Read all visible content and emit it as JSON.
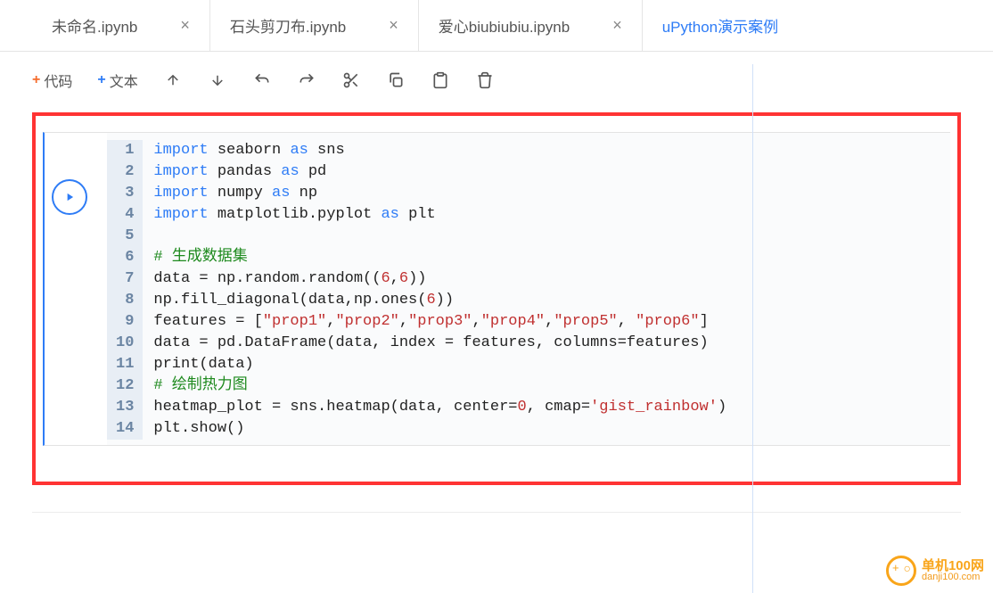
{
  "tabs": [
    {
      "label": "未命名.ipynb",
      "active": false
    },
    {
      "label": "石头剪刀布.ipynb",
      "active": false
    },
    {
      "label": "爱心biubiubiu.ipynb",
      "active": false
    },
    {
      "label": "uPython演示案例",
      "active": true
    }
  ],
  "toolbar": {
    "add_code": "代码",
    "add_text": "文本"
  },
  "code": {
    "lines": [
      {
        "n": 1,
        "tokens": [
          {
            "t": "import",
            "c": "kw"
          },
          {
            "t": " seaborn "
          },
          {
            "t": "as",
            "c": "kw"
          },
          {
            "t": " sns"
          }
        ]
      },
      {
        "n": 2,
        "tokens": [
          {
            "t": "import",
            "c": "kw"
          },
          {
            "t": " pandas "
          },
          {
            "t": "as",
            "c": "kw"
          },
          {
            "t": " pd"
          }
        ]
      },
      {
        "n": 3,
        "tokens": [
          {
            "t": "import",
            "c": "kw"
          },
          {
            "t": " numpy "
          },
          {
            "t": "as",
            "c": "kw"
          },
          {
            "t": " np"
          }
        ]
      },
      {
        "n": 4,
        "tokens": [
          {
            "t": "import",
            "c": "kw"
          },
          {
            "t": " matplotlib.pyplot "
          },
          {
            "t": "as",
            "c": "kw"
          },
          {
            "t": " plt"
          }
        ]
      },
      {
        "n": 5,
        "tokens": [
          {
            "t": ""
          }
        ]
      },
      {
        "n": 6,
        "tokens": [
          {
            "t": "# 生成数据集",
            "c": "com"
          }
        ]
      },
      {
        "n": 7,
        "tokens": [
          {
            "t": "data = np.random.random(("
          },
          {
            "t": "6",
            "c": "num"
          },
          {
            "t": ","
          },
          {
            "t": "6",
            "c": "num"
          },
          {
            "t": "))"
          }
        ]
      },
      {
        "n": 8,
        "tokens": [
          {
            "t": "np.fill_diagonal(data,np.ones("
          },
          {
            "t": "6",
            "c": "num"
          },
          {
            "t": "))"
          }
        ]
      },
      {
        "n": 9,
        "tokens": [
          {
            "t": "features = ["
          },
          {
            "t": "\"prop1\"",
            "c": "str"
          },
          {
            "t": ","
          },
          {
            "t": "\"prop2\"",
            "c": "str"
          },
          {
            "t": ","
          },
          {
            "t": "\"prop3\"",
            "c": "str"
          },
          {
            "t": ","
          },
          {
            "t": "\"prop4\"",
            "c": "str"
          },
          {
            "t": ","
          },
          {
            "t": "\"prop5\"",
            "c": "str"
          },
          {
            "t": ", "
          },
          {
            "t": "\"prop6\"",
            "c": "str"
          },
          {
            "t": "]"
          }
        ]
      },
      {
        "n": 10,
        "tokens": [
          {
            "t": "data = pd.DataFrame(data, index = features, columns=features)"
          }
        ]
      },
      {
        "n": 11,
        "tokens": [
          {
            "t": "print(data)"
          }
        ]
      },
      {
        "n": 12,
        "tokens": [
          {
            "t": "# 绘制热力图",
            "c": "com"
          }
        ]
      },
      {
        "n": 13,
        "tokens": [
          {
            "t": "heatmap_plot = sns.heatmap(data, center="
          },
          {
            "t": "0",
            "c": "num"
          },
          {
            "t": ", cmap="
          },
          {
            "t": "'gist_rainbow'",
            "c": "str"
          },
          {
            "t": ")"
          }
        ]
      },
      {
        "n": 14,
        "tokens": [
          {
            "t": "plt.show()"
          }
        ]
      }
    ]
  },
  "watermark": {
    "title": "单机100网",
    "sub": "danji100.com"
  }
}
